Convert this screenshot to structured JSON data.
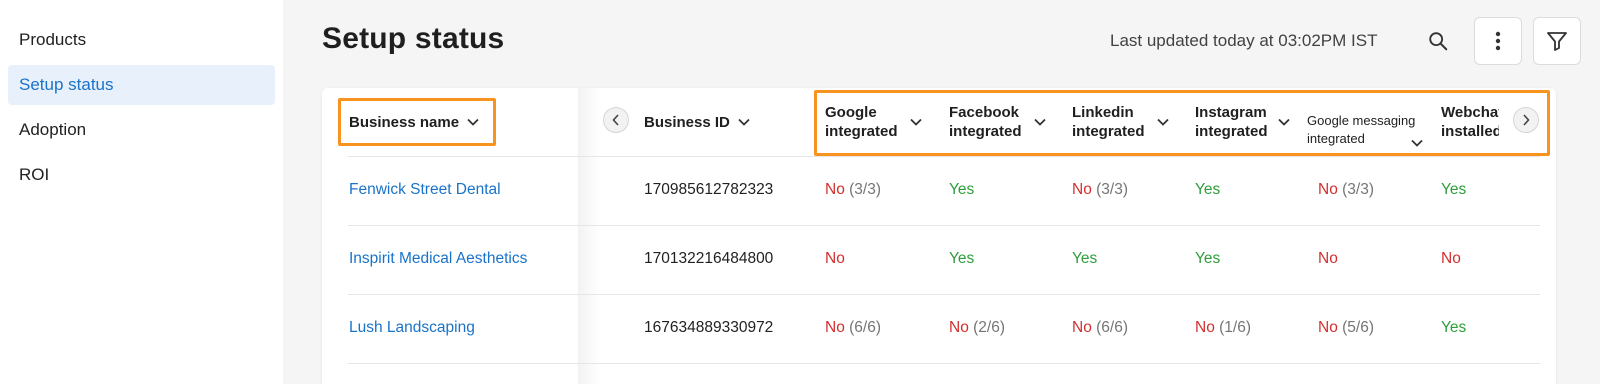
{
  "sidebar": {
    "items": [
      {
        "label": "Products",
        "active": false
      },
      {
        "label": "Setup status",
        "active": true
      },
      {
        "label": "Adoption",
        "active": false
      },
      {
        "label": "ROI",
        "active": false
      }
    ]
  },
  "header": {
    "title": "Setup status",
    "last_updated": "Last updated today at 03:02PM IST",
    "icons": [
      "search-icon",
      "more-vert-icon",
      "filter-icon"
    ]
  },
  "table": {
    "columns": [
      {
        "line1": "Business name",
        "line2": ""
      },
      {
        "line1": "Business ID",
        "line2": ""
      },
      {
        "line1": "Google",
        "line2": "integrated"
      },
      {
        "line1": "Facebook",
        "line2": "integrated"
      },
      {
        "line1": "Linkedin",
        "line2": "integrated"
      },
      {
        "line1": "Instagram",
        "line2": "integrated"
      },
      {
        "line1": "Google messaging",
        "line2": "integrated"
      },
      {
        "line1": "Webchat",
        "line2": "installed"
      }
    ],
    "rows": [
      {
        "name": "Fenwick Street Dental",
        "id": "170985612782323",
        "google": {
          "status": "No",
          "count": "(3/3)"
        },
        "facebook": {
          "status": "Yes",
          "count": ""
        },
        "linkedin": {
          "status": "No",
          "count": "(3/3)"
        },
        "instagram": {
          "status": "Yes",
          "count": ""
        },
        "gmessaging": {
          "status": "No",
          "count": "(3/3)"
        },
        "webchat": {
          "status": "Yes",
          "count": ""
        }
      },
      {
        "name": "Inspirit Medical Aesthetics",
        "id": "170132216484800",
        "google": {
          "status": "No",
          "count": ""
        },
        "facebook": {
          "status": "Yes",
          "count": ""
        },
        "linkedin": {
          "status": "Yes",
          "count": ""
        },
        "instagram": {
          "status": "Yes",
          "count": ""
        },
        "gmessaging": {
          "status": "No",
          "count": ""
        },
        "webchat": {
          "status": "No",
          "count": ""
        }
      },
      {
        "name": "Lush Landscaping",
        "id": "167634889330972",
        "google": {
          "status": "No",
          "count": "(6/6)"
        },
        "facebook": {
          "status": "No",
          "count": "(2/6)"
        },
        "linkedin": {
          "status": "No",
          "count": "(6/6)"
        },
        "instagram": {
          "status": "No",
          "count": "(1/6)"
        },
        "gmessaging": {
          "status": "No",
          "count": "(5/6)"
        },
        "webchat": {
          "status": "Yes",
          "count": ""
        }
      }
    ]
  },
  "colors": {
    "accent": "#1a73c9",
    "yes": "#2e9e3b",
    "no": "#d32f2f",
    "highlight": "#f7931e"
  }
}
